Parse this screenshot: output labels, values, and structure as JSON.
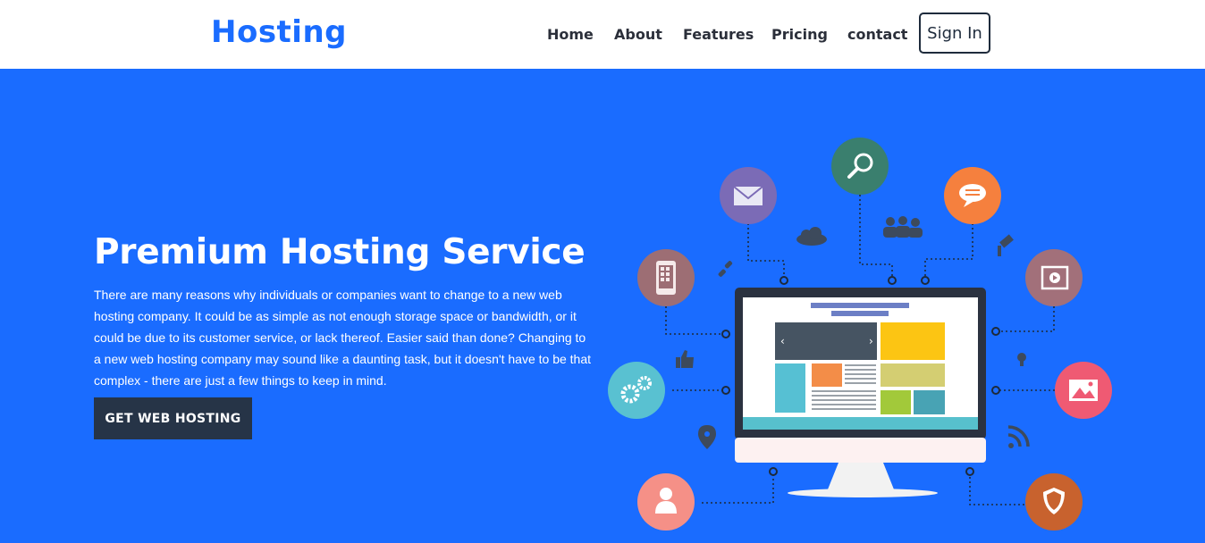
{
  "navbar": {
    "brand": "Hosting",
    "links": [
      "Home",
      "About",
      "Features",
      "Pricing",
      "contact"
    ],
    "signin_label": "Sign In"
  },
  "hero": {
    "title": "Premium Hosting Service",
    "description": "There are many reasons why individuals or companies want to change to a new web hosting company. It could be as simple as not enough storage space or bandwidth, or it could be due to its customer service, or lack thereof. Easier said than done? Changing to a new web hosting company may sound like a daunting task, but it doesn't have to be that complex - there are just a few things to keep in mind.",
    "cta_label": "GET WEB HOSTING"
  },
  "colors": {
    "brand": "#1a6cff",
    "hero_bg": "#1a6cff",
    "nav_bg": "#ffffff",
    "cta_bg": "#263447"
  },
  "illustration": {
    "icons": [
      "search-icon",
      "mail-icon",
      "chat-icon",
      "phone-icon",
      "video-icon",
      "gears-icon",
      "image-icon",
      "user-icon",
      "shield-icon",
      "cloud-icon",
      "users-icon",
      "link-icon",
      "thumbs-up-icon",
      "pin-icon",
      "rss-icon",
      "satellite-icon",
      "bulb-icon"
    ]
  }
}
